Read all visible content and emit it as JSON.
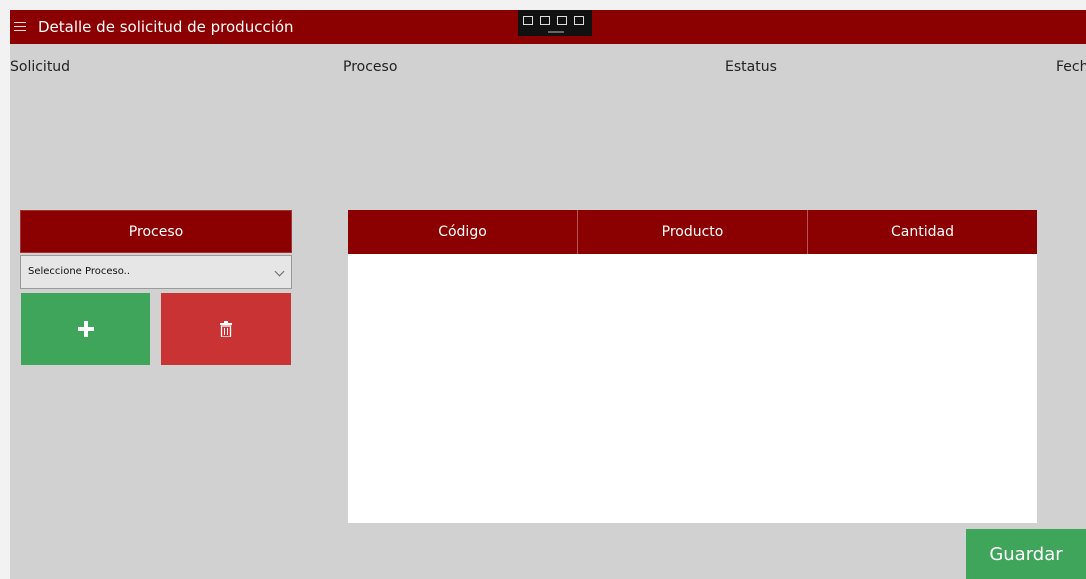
{
  "window": {
    "title": "Detalle de solicitud de producción"
  },
  "header_fields": {
    "solicitud": "Solicitud",
    "proceso": "Proceso",
    "estatus": "Estatus",
    "fecha": "Fecha"
  },
  "process_panel": {
    "header": "Proceso",
    "select_value": "Seleccione Proceso..",
    "add_label": "+"
  },
  "table": {
    "columns": [
      "Código",
      "Producto",
      "Cantidad"
    ],
    "rows": []
  },
  "actions": {
    "save_label": "Guardar"
  },
  "icons": {
    "menu": "hamburger-icon",
    "dropdown": "chevron-down-icon",
    "add": "plus-icon",
    "delete": "trash-icon"
  },
  "colors": {
    "accent": "#8b0000",
    "success": "#3fa55a",
    "danger": "#c93333",
    "background": "#d1d1d1"
  }
}
